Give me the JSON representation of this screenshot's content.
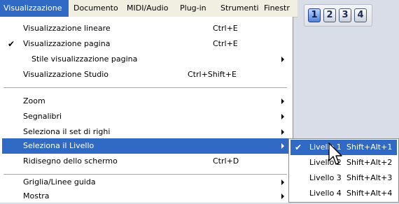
{
  "menubar": {
    "items": [
      "Visualizzazione",
      "Documento",
      "MIDI/Audio",
      "Plug-in",
      "Strumenti",
      "Finestr"
    ]
  },
  "level_toolbar": {
    "buttons": [
      "1",
      "2",
      "3",
      "4"
    ],
    "active_level": "1"
  },
  "main_menu": {
    "items": [
      {
        "label": "Visualizzazione lineare",
        "shortcut": "Ctrl+E"
      },
      {
        "label": "Visualizzazione pagina",
        "shortcut": "Ctrl+E",
        "checked": true
      },
      {
        "label": "Stile visualizzazione pagina",
        "submenu": true
      },
      {
        "label": "Visualizzazione Studio",
        "shortcut": "Ctrl+Shift+E"
      },
      {
        "label": "Zoom",
        "submenu": true
      },
      {
        "label": "Segnalibri",
        "submenu": true
      },
      {
        "label": "Seleziona il set di righi",
        "submenu": true
      },
      {
        "label": "Seleziona il Livello",
        "submenu": true,
        "highlighted": true
      },
      {
        "label": "Ridisegno dello schermo",
        "shortcut": "Ctrl+D"
      },
      {
        "label": "Griglia/Linee guida",
        "submenu": true
      },
      {
        "label": "Mostra",
        "submenu": true
      }
    ]
  },
  "sub_menu": {
    "items": [
      {
        "label": "Livello 1",
        "shortcut": "Shift+Alt+1",
        "checked": true,
        "highlighted": true
      },
      {
        "label": "Livello 2",
        "shortcut": "Shift+Alt+2"
      },
      {
        "label": "Livello 3",
        "shortcut": "Shift+Alt+3"
      },
      {
        "label": "Livello 4",
        "shortcut": "Shift+Alt+4"
      }
    ]
  },
  "colors": {
    "highlight": "#316ac5",
    "menu_background": "#ffffff",
    "menubar_background": "#f1efe2"
  },
  "icons": {
    "check": "check-icon",
    "submenu_arrow": "submenu-arrow-icon",
    "cursor": "mouse-pointer-icon"
  }
}
